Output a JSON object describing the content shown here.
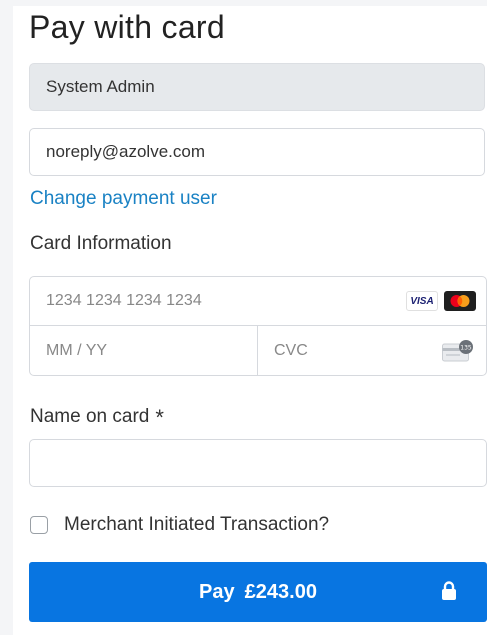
{
  "title": "Pay with card",
  "user_name": {
    "value": "System Admin"
  },
  "email": {
    "value": "noreply@azolve.com"
  },
  "change_user_link": "Change payment user",
  "card_info_label": "Card Information",
  "card": {
    "number_placeholder": "1234 1234 1234 1234",
    "expiry_placeholder": "MM / YY",
    "cvc_placeholder": "CVC",
    "brands": [
      "VISA",
      "Mastercard"
    ],
    "visa_text": "VISA",
    "cvc_icon_text": "135"
  },
  "name_on_card": {
    "label": "Name on card",
    "required_mark": "*",
    "value": ""
  },
  "mit_checkbox": {
    "label": "Merchant Initiated Transaction?",
    "checked": false
  },
  "pay_button": {
    "label": "Pay",
    "amount": "£243.00"
  },
  "colors": {
    "accent": "#0875e1",
    "link": "#1a82c4",
    "disabled_field": "#e6e9ec",
    "border": "#d6d9de"
  }
}
